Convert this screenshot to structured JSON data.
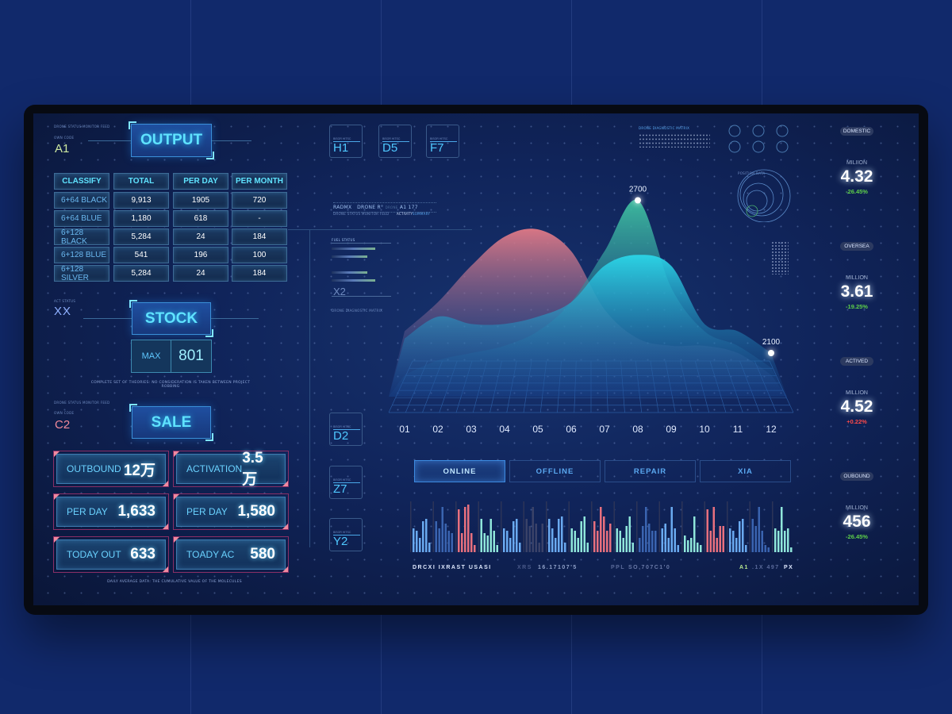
{
  "colors": {
    "accent": "#5fe3ff",
    "pink": "#e06a78",
    "teal": "#3fb8a0",
    "cyan": "#2bd6e8",
    "up_red": "#ff4a4a",
    "down_green": "#5ed04a"
  },
  "left": {
    "status_label": "DRONE STATUS   MONITOR FEED",
    "code_label": "OWN CODE",
    "code_a": "A1",
    "act_status": "ACT STATUS",
    "xx": "XX",
    "code_c": "C2",
    "output": {
      "title": "OUTPUT",
      "headers": [
        "CLASSIFY",
        "TOTAL",
        "PER DAY",
        "PER MONTH"
      ],
      "rows": [
        [
          "6+64 BLACK",
          "9,913",
          "1905",
          "720"
        ],
        [
          "6+64 BLUE",
          "1,180",
          "618",
          "-"
        ],
        [
          "6+128 BLACK",
          "5,284",
          "24",
          "184"
        ],
        [
          "6+128 BLUE",
          "541",
          "196",
          "100"
        ],
        [
          "6+128 SILVER",
          "5,284",
          "24",
          "184"
        ]
      ]
    },
    "stock": {
      "title": "STOCK",
      "max_label": "MAX",
      "max_value": "801",
      "caption": "COMPLETE SET OF THEORIES: NO CONSIDERATION IS TAKEN BETWEEN PROJECT ROBBING"
    },
    "sale": {
      "title": "SALE",
      "cards": [
        {
          "label": "OUTBOUND",
          "value": "12万"
        },
        {
          "label": "ACTIVATION",
          "value": "3.5万"
        },
        {
          "label": "PER DAY",
          "value": "1,633"
        },
        {
          "label": "PER DAY",
          "value": "1,580"
        },
        {
          "label": "TODAY OUT",
          "value": "633"
        },
        {
          "label": "TOADY AC",
          "value": "580"
        }
      ],
      "caption": "DAILY AVERAGE DATA: THE CUMULATIVE VALUE OF THE MOLECULES"
    }
  },
  "middle": {
    "code_caption": "BISOR  HITSC",
    "top_codes": [
      "H1",
      "D5",
      "F7"
    ],
    "side_codes": [
      "D2",
      "Z7",
      "Y2"
    ],
    "readout": {
      "a": "RADMX",
      "b": "DRONE R°",
      "c": "DRONE",
      "d": "A1  177",
      "e": "DRONE STATUS   MONITOR FEED",
      "f": "ACTIVITY",
      "g": "SUMMARY"
    },
    "fuel_status": "FUEL STATUS",
    "x2": "X2",
    "diag": "DRONE DIAGNOSTIC MATRIX",
    "position": "POSITION DATA",
    "tabs": [
      {
        "label": "ONLINE",
        "active": true
      },
      {
        "label": "OFFLINE"
      },
      {
        "label": "REPAIR"
      },
      {
        "label": "XIA"
      }
    ],
    "footer": {
      "a": "DRCXI IXRAST USASI",
      "b_key": "XRS",
      "b_val": "16.17107'5",
      "c_key": "PPL",
      "c_val": "SO,707C1'0",
      "d_key": "A1",
      "d_mid": ".1X 497",
      "d_unit": "PX"
    }
  },
  "gauges": [
    {
      "label": "DOMESTIC",
      "unit": "MILIION",
      "value": "4.32",
      "change": "-26.45%",
      "trend": "down"
    },
    {
      "label": "OVERSEA",
      "unit": "MILLION",
      "value": "3.61",
      "change": "-19.25%",
      "trend": "down"
    },
    {
      "label": "ACTIVED",
      "unit": "MILLION",
      "value": "4.52",
      "change": "+0.22%",
      "trend": "up"
    },
    {
      "label": "OUBOUND",
      "unit": "MILLION",
      "value": "456",
      "change": "-26.45%",
      "trend": "down"
    }
  ],
  "chart_data": [
    {
      "type": "area",
      "categories": [
        "01",
        "02",
        "03",
        "04",
        "05",
        "06",
        "07",
        "08",
        "09",
        "10",
        "11",
        "12"
      ],
      "ylim": [
        0,
        3000
      ],
      "grid": false,
      "series": [
        {
          "color": "#e27a86",
          "values": [
            900,
            1300,
            1800,
            2200,
            2300,
            2000,
            1200,
            800,
            700,
            700,
            600,
            300
          ]
        },
        {
          "color": "#3fc0a0",
          "values": [
            300,
            500,
            600,
            700,
            900,
            1300,
            2000,
            2700,
            1500,
            900,
            700,
            400
          ]
        },
        {
          "color": "#2bd6e8",
          "values": [
            800,
            1100,
            1000,
            1000,
            1100,
            1300,
            1800,
            1950,
            1800,
            1000,
            900,
            600
          ]
        }
      ],
      "annotations": [
        {
          "category": "08",
          "series": 1,
          "label": "2700"
        },
        {
          "category": "12",
          "series": 2,
          "label": "2100"
        }
      ]
    },
    {
      "type": "bar",
      "ylim": [
        0,
        100
      ],
      "groups": [
        {
          "color": "#6aaaf0",
          "values": [
            50,
            45,
            30,
            65,
            70,
            20
          ]
        },
        {
          "color": "#3a64b0",
          "values": [
            65,
            50,
            95,
            60,
            45,
            40
          ]
        },
        {
          "color": "#e8707e",
          "values": [
            90,
            40,
            95,
            100,
            40,
            15
          ]
        },
        {
          "color": "#8fe6da",
          "values": [
            70,
            40,
            35,
            70,
            45,
            15
          ]
        },
        {
          "color": "#6aaaf0",
          "values": [
            50,
            45,
            30,
            65,
            70,
            20
          ]
        },
        {
          "color": "#3a4268",
          "values": [
            70,
            55,
            95,
            60,
            20,
            60
          ]
        },
        {
          "color": "#6aaaf0",
          "values": [
            70,
            50,
            30,
            70,
            75,
            20
          ]
        },
        {
          "color": "#8fe6da",
          "values": [
            50,
            45,
            30,
            65,
            75,
            20
          ]
        },
        {
          "color": "#e8707e",
          "values": [
            65,
            45,
            95,
            75,
            45,
            60
          ]
        },
        {
          "color": "#8fe6da",
          "values": [
            50,
            45,
            30,
            55,
            75,
            20
          ]
        },
        {
          "color": "#3a64b0",
          "values": [
            30,
            55,
            95,
            60,
            45,
            45
          ]
        },
        {
          "color": "#6aaaf0",
          "values": [
            50,
            60,
            30,
            95,
            50,
            15
          ]
        },
        {
          "color": "#8fe6da",
          "values": [
            35,
            25,
            30,
            75,
            20,
            15
          ]
        },
        {
          "color": "#e8707e",
          "values": [
            90,
            45,
            95,
            30,
            55,
            55
          ]
        },
        {
          "color": "#6aaaf0",
          "values": [
            50,
            45,
            30,
            65,
            70,
            15
          ]
        },
        {
          "color": "#3a64b0",
          "values": [
            70,
            55,
            95,
            45,
            15,
            10
          ]
        },
        {
          "color": "#8fe6da",
          "values": [
            50,
            45,
            95,
            45,
            50,
            10
          ]
        }
      ]
    }
  ]
}
